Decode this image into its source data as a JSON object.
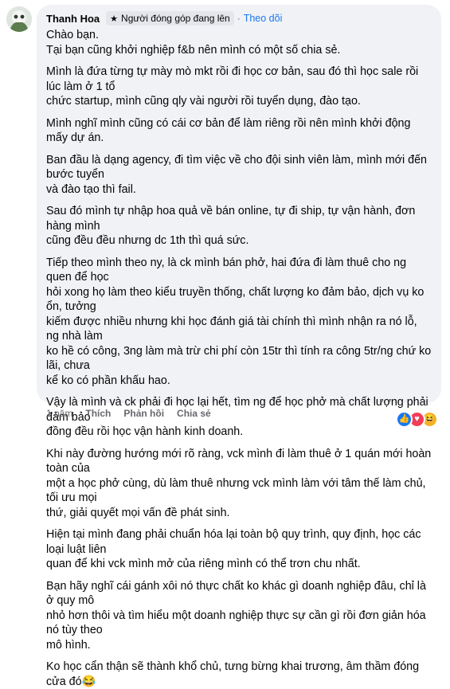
{
  "comment": {
    "author": "Thanh Hoa",
    "badge_text": "Người đóng góp đang lên",
    "dot": "·",
    "follow_label": "Theo dõi",
    "paragraphs": [
      "Chào bạn.\nTại bạn cũng khởi nghiệp f&b nên mình có một số chia sẻ.",
      "Mình là đứa từng tự mày mò mkt rồi đi học cơ bản, sau đó thì học sale rồi lúc làm ở 1 tổ\nchức startup, mình cũng qly vài người rồi tuyển dụng, đào tạo.",
      "Mình nghĩ mình cũng có cái cơ bản để làm riêng rồi nên mình khởi động mấy dự án.",
      "Ban đầu là dạng agency, đi tìm việc về cho đội sinh viên làm, mình mới đến bước tuyển\nvà đào tạo thì fail.",
      "Sau đó mình tự nhập hoa quả về bán online, tự đi ship, tự vận hành, đơn hàng mình\ncũng đều đều nhưng dc 1th thì quá sức.",
      "Tiếp theo mình theo ny, là ck mình bán phở, hai đứa đi làm thuê cho ng quen để học\nhỏi xong họ làm theo kiểu truyền thống, chất lượng ko đảm bảo, dịch vụ ko ổn, tưởng\nkiếm được nhiều nhưng khi học đánh giá tài chính thì mình nhận ra nó lỗ, ng nhà làm\nko hề có công, 3ng làm mà trừ chi phí còn 15tr thì tính ra công 5tr/ng chứ ko lãi, chưa\nkể ko có phần khấu hao.",
      "Vậy là mình và ck phải đi học lại hết, tìm ng để học phở mà chất lượng phải đảm bảo\nđồng đều rồi học vận hành kinh doanh.",
      "Khi này đường hướng mới rõ ràng, vck mình đi làm thuê ở 1 quán mới hoàn toàn của\nmột a học phở cùng, dù làm thuê nhưng vck mình làm với tâm thế làm chủ, tối ưu mọi\nthứ, giải quyết mọi vấn đề phát sinh.",
      "Hiện tại mình đang phải chuẩn hóa lại toàn bộ quy trình, quy định, học các loại luật liên\nquan để khi vck mình mở của riêng mình có thể trơn chu nhất.",
      "Bạn hãy nghĩ cái gánh xôi nó thực chất ko khác gì doanh nghiệp đâu, chỉ là ở quy mô\nnhỏ hơn thôi và tìm hiểu một doanh nghiệp thực sự cần gì rồi đơn giản hóa nó tùy theo\nmô hình.",
      "Ko học cẩn thận sẽ thành khổ chủ, tưng bừng khai trương, âm thầm đóng cửa đó😂"
    ]
  },
  "footer": {
    "time": "1 năm",
    "like_label": "Thích",
    "reply_label": "Phản hồi",
    "share_label": "Chia sẻ"
  },
  "reactions": [
    {
      "name": "like",
      "color": "#1877f2",
      "glyph": "👍"
    },
    {
      "name": "love",
      "color": "#f33e58",
      "glyph": "♥"
    },
    {
      "name": "haha",
      "color": "#f7b125",
      "glyph": "😆"
    }
  ]
}
